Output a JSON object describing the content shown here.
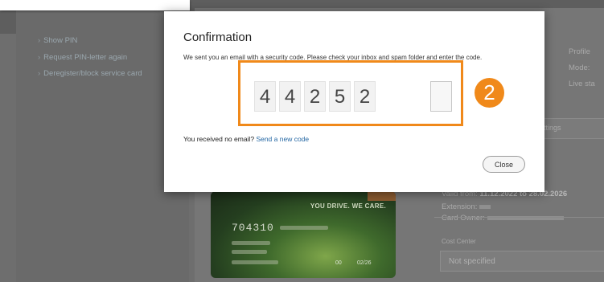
{
  "sidebar": {
    "links": [
      "Show PIN",
      "Request PIN-letter again",
      "Deregister/block service card"
    ]
  },
  "background_right": {
    "labels": [
      "Profile",
      "Mode:",
      "Live sta"
    ],
    "tab_label": "ttings",
    "valid_from_label": "Valid from:",
    "valid_from_value": "11.12.2022 to 28.02.2026",
    "extension_label": "Extension:",
    "card_owner_label": "Card Owner:",
    "cost_center_label": "Cost Center",
    "cost_center_value": "Not specified"
  },
  "card": {
    "slogan": "YOU DRIVE. WE CARE.",
    "number_prefix": "704310",
    "expiry": "02/26",
    "mid": "00"
  },
  "modal": {
    "title": "Confirmation",
    "description": "We sent you an email with a security code. Please check your inbox and spam folder and enter the code.",
    "code_digits": [
      "4",
      "4",
      "2",
      "5",
      "2",
      ""
    ],
    "step_badge": "2",
    "no_email_text": "You received no email?",
    "resend_link": "Send a new code",
    "close_label": "Close"
  },
  "colors": {
    "accent": "#f0891a",
    "link": "#2467a3"
  }
}
